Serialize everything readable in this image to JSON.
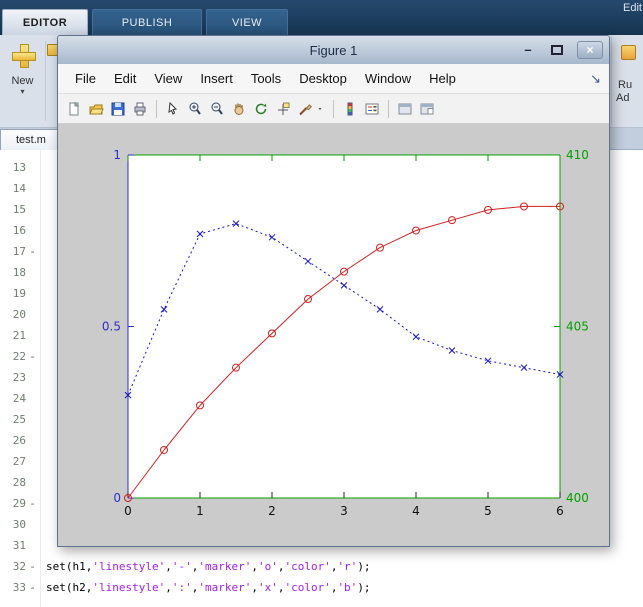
{
  "ribbon": {
    "tabs": [
      {
        "label": "EDITOR",
        "active": true
      },
      {
        "label": "PUBLISH",
        "active": false
      },
      {
        "label": "VIEW",
        "active": false
      }
    ],
    "corner_label": "Edit",
    "new_label": "New",
    "run_partial_top": "Ru",
    "run_partial_bottom": "Ad"
  },
  "icons": {
    "new_caret": "▾",
    "dock_arrow": "↘",
    "minimize": "–",
    "close": "×"
  },
  "editor": {
    "file_tab": "test.m",
    "gutter": {
      "start_line": 13,
      "end_line": 33,
      "executable_lines": [
        17,
        22,
        29,
        32,
        33
      ]
    },
    "code_lines": [
      {
        "line": 32,
        "tokens": [
          {
            "text": "set(h1,",
            "type": "code"
          },
          {
            "text": "'linestyle'",
            "type": "string"
          },
          {
            "text": ",",
            "type": "code"
          },
          {
            "text": "'-'",
            "type": "string"
          },
          {
            "text": ",",
            "type": "code"
          },
          {
            "text": "'marker'",
            "type": "string"
          },
          {
            "text": ",",
            "type": "code"
          },
          {
            "text": "'o'",
            "type": "string"
          },
          {
            "text": ",",
            "type": "code"
          },
          {
            "text": "'color'",
            "type": "string"
          },
          {
            "text": ",",
            "type": "code"
          },
          {
            "text": "'r'",
            "type": "string"
          },
          {
            "text": ");",
            "type": "code"
          }
        ]
      },
      {
        "line": 33,
        "tokens": [
          {
            "text": "set(h2,",
            "type": "code"
          },
          {
            "text": "'linestyle'",
            "type": "string"
          },
          {
            "text": ",",
            "type": "code"
          },
          {
            "text": "':'",
            "type": "string"
          },
          {
            "text": ",",
            "type": "code"
          },
          {
            "text": "'marker'",
            "type": "string"
          },
          {
            "text": ",",
            "type": "code"
          },
          {
            "text": "'x'",
            "type": "string"
          },
          {
            "text": ",",
            "type": "code"
          },
          {
            "text": "'color'",
            "type": "string"
          },
          {
            "text": ",",
            "type": "code"
          },
          {
            "text": "'b'",
            "type": "string"
          },
          {
            "text": ");",
            "type": "code"
          }
        ]
      }
    ]
  },
  "figure_window": {
    "title": "Figure 1",
    "menu": [
      "File",
      "Edit",
      "View",
      "Insert",
      "Tools",
      "Desktop",
      "Window",
      "Help"
    ],
    "toolbar_icons": [
      "new-figure",
      "open-file",
      "save-figure",
      "print-figure",
      "sep",
      "edit-plot",
      "zoom-in",
      "zoom-out",
      "pan",
      "rotate-3d",
      "data-cursor",
      "brush",
      "brush-caret",
      "sep",
      "insert-colorbar",
      "insert-legend",
      "sep",
      "hide-plot-tools",
      "show-plot-tools"
    ]
  },
  "chart_data": {
    "type": "line",
    "x": [
      0,
      0.5,
      1,
      1.5,
      2,
      2.5,
      3,
      3.5,
      4,
      4.5,
      5,
      5.5,
      6
    ],
    "series": [
      {
        "name": "h1",
        "color": "#d02020",
        "linestyle": "solid",
        "marker": "o",
        "axis": "left",
        "values": [
          0,
          0.14,
          0.27,
          0.38,
          0.48,
          0.58,
          0.66,
          0.73,
          0.78,
          0.81,
          0.84,
          0.85,
          0.85
        ]
      },
      {
        "name": "h2",
        "color": "#1515cc",
        "linestyle": "dotted",
        "marker": "x",
        "axis": "left",
        "values": [
          0.3,
          0.55,
          0.77,
          0.8,
          0.76,
          0.69,
          0.62,
          0.55,
          0.47,
          0.43,
          0.4,
          0.38,
          0.36
        ]
      }
    ],
    "title": "",
    "xlabel": "",
    "ylabel": "",
    "xlim": [
      0,
      6
    ],
    "xticks": [
      0,
      1,
      2,
      3,
      4,
      5,
      6
    ],
    "xtick_labels": [
      "0",
      "1",
      "2",
      "3",
      "4",
      "5",
      "6"
    ],
    "left_axis": {
      "color": "#3030cc",
      "lim": [
        0,
        1
      ],
      "ticks": [
        0,
        0.5,
        1
      ],
      "labels": [
        "0",
        "0.5",
        "1"
      ]
    },
    "right_axis": {
      "color": "#00a000",
      "lim": [
        400,
        410
      ],
      "ticks": [
        400,
        405,
        410
      ],
      "labels": [
        "400",
        "405",
        "410"
      ]
    },
    "grid": false,
    "legend": null,
    "plot_bg": "#ffffff",
    "figure_bg": "#cbcbcb",
    "xtick_color": "#111111"
  }
}
